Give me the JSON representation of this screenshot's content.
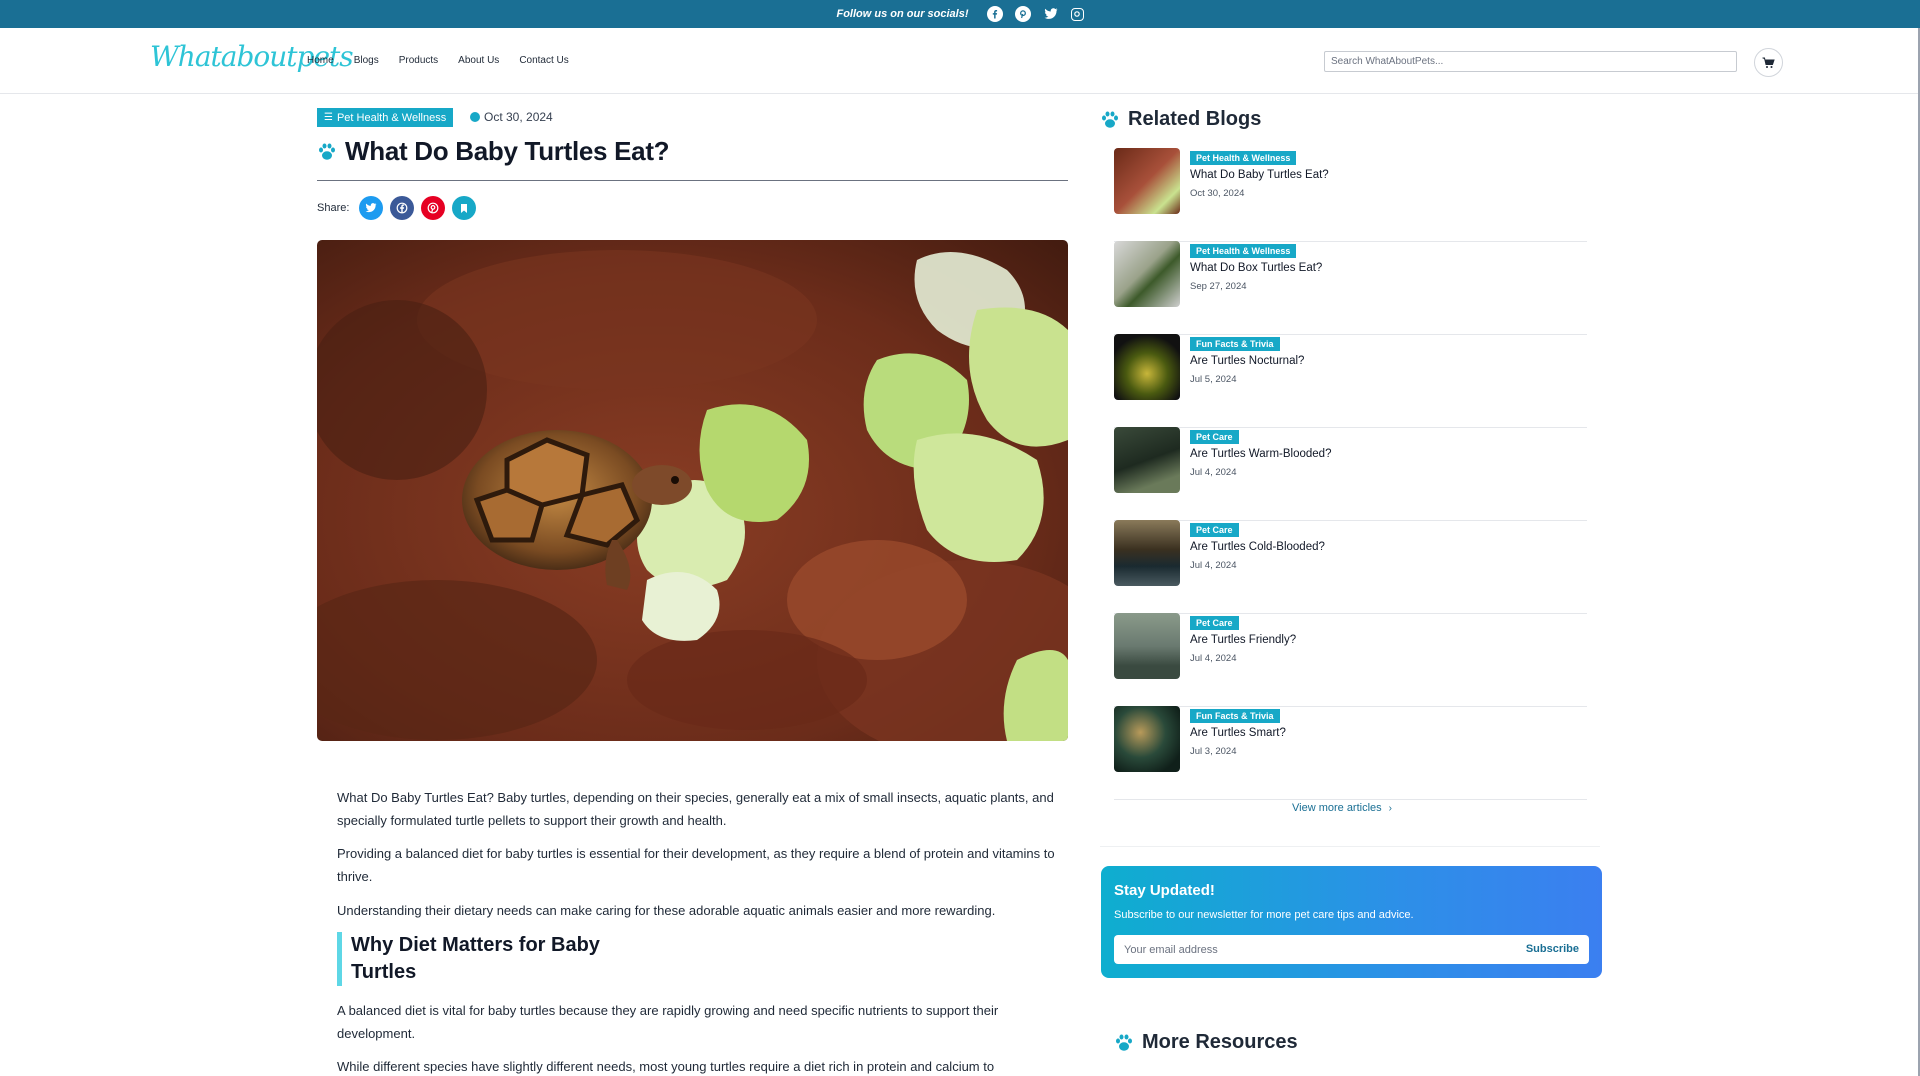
{
  "topbar": {
    "follow_text": "Follow us on our socials!",
    "icons": [
      "facebook-icon",
      "pinterest-icon",
      "twitter-icon",
      "instagram-icon"
    ],
    "bg_color": "#1a6f94"
  },
  "header": {
    "logo": "Whataboutpets",
    "nav": [
      "Home",
      "Blogs",
      "Products",
      "About Us",
      "Contact Us"
    ],
    "search_placeholder": "Search WhatAboutPets..."
  },
  "article": {
    "category": "Pet Health & Wellness",
    "date": "Oct 30, 2024",
    "title": "What Do Baby Turtles Eat?",
    "share_label": "Share:",
    "paragraphs": [
      "What Do Baby Turtles Eat? Baby turtles, depending on their species, generally eat a mix of small insects, aquatic plants, and specially formulated turtle pellets to support their growth and health.",
      "Providing a balanced diet for baby turtles is essential for their development, as they require a blend of protein and vitamins to thrive.",
      "Understanding their dietary needs can make caring for these adorable aquatic animals easier and more rewarding."
    ],
    "section_heading": "Why Diet Matters for Baby Turtles",
    "section_paragraphs": [
      "A balanced diet is vital for baby turtles because they are rapidly growing and need specific nutrients to support their development.",
      "While different species have slightly different needs, most young turtles require a diet rich in protein and calcium to"
    ]
  },
  "sidebar": {
    "related_heading": "Related Blogs",
    "related": [
      {
        "category": "Pet Health & Wellness",
        "title": "What Do Baby Turtles Eat?",
        "date": "Oct 30, 2024"
      },
      {
        "category": "Pet Health & Wellness",
        "title": "What Do Box Turtles Eat?",
        "date": "Sep 27, 2024"
      },
      {
        "category": "Fun Facts & Trivia",
        "title": "Are Turtles Nocturnal?",
        "date": "Jul 5, 2024"
      },
      {
        "category": "Pet Care",
        "title": "Are Turtles Warm-Blooded?",
        "date": "Jul 4, 2024"
      },
      {
        "category": "Pet Care",
        "title": "Are Turtles Cold-Blooded?",
        "date": "Jul 4, 2024"
      },
      {
        "category": "Pet Care",
        "title": "Are Turtles Friendly?",
        "date": "Jul 4, 2024"
      },
      {
        "category": "Fun Facts & Trivia",
        "title": "Are Turtles Smart?",
        "date": "Jul 3, 2024"
      }
    ],
    "view_more": "View more articles",
    "newsletter": {
      "heading": "Stay Updated!",
      "text": "Subscribe to our newsletter for more pet care tips and advice.",
      "placeholder": "Your email address",
      "button": "Subscribe"
    },
    "more_resources": "More Resources"
  },
  "colors": {
    "accent": "#17a8c7",
    "brand_dark": "#1a6f94",
    "logo": "#2ec4d6"
  }
}
